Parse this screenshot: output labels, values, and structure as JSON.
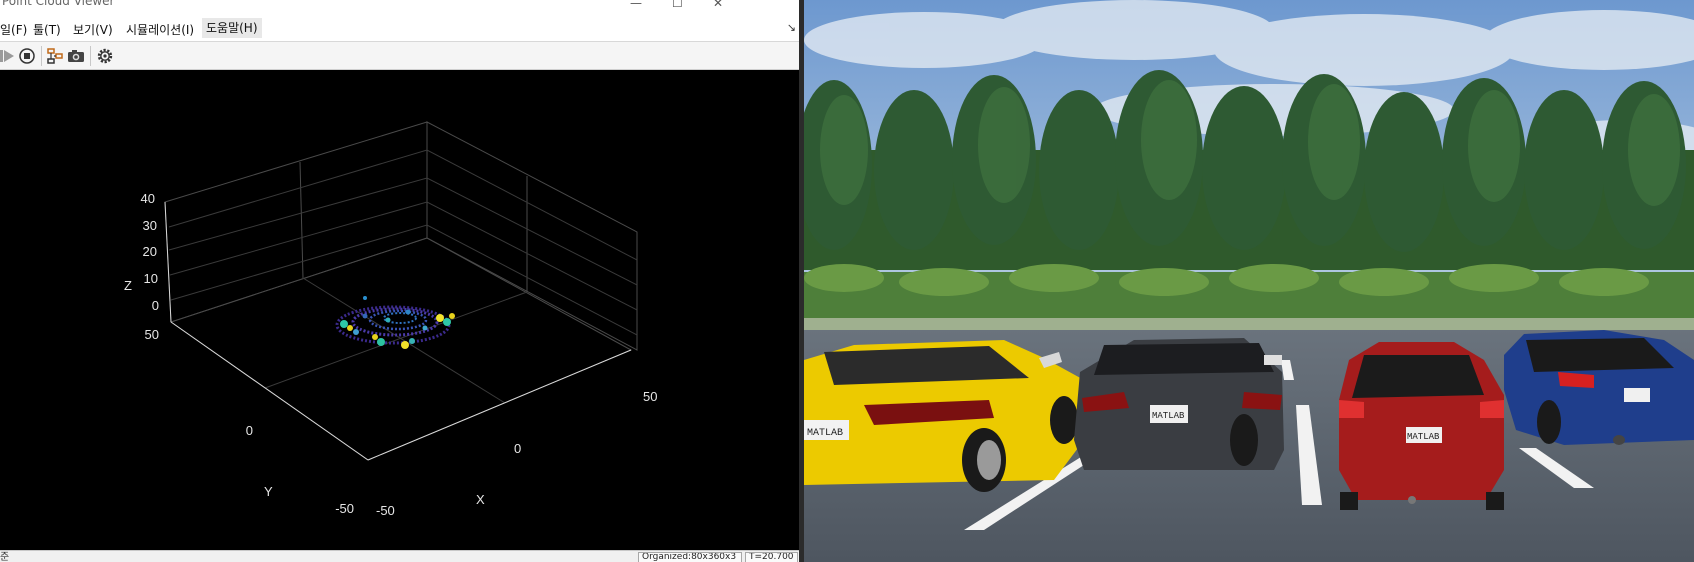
{
  "window": {
    "title": "Point Cloud Viewer"
  },
  "menu": {
    "items": [
      "일(F)",
      "툴(T)",
      "보기(V)",
      "시뮬레이션(I)",
      "도움말(H)"
    ],
    "collapse_glyph": "↘"
  },
  "toolbar": {
    "icons": [
      "play-icon",
      "stop-icon",
      "step-icon",
      "camera-icon",
      "settings-icon"
    ]
  },
  "plot": {
    "z_label": "Z",
    "y_label": "Y",
    "x_label": "X",
    "z_ticks": [
      "40",
      "30",
      "20",
      "10",
      "0"
    ],
    "y_ticks": [
      "50",
      "0",
      "-50"
    ],
    "x_ticks": [
      "-50",
      "0",
      "50"
    ]
  },
  "status": {
    "left": "준",
    "organized": "Organized:80x360x3",
    "time": "T=20.700"
  },
  "scene": {
    "plate_text": "MATLAB",
    "colors": {
      "sky": "#7fa6d6",
      "yellow_car": "#f0d000",
      "black_car": "#3a3d42",
      "red_car": "#a51c1c",
      "blue_car": "#1f3e8c"
    }
  }
}
